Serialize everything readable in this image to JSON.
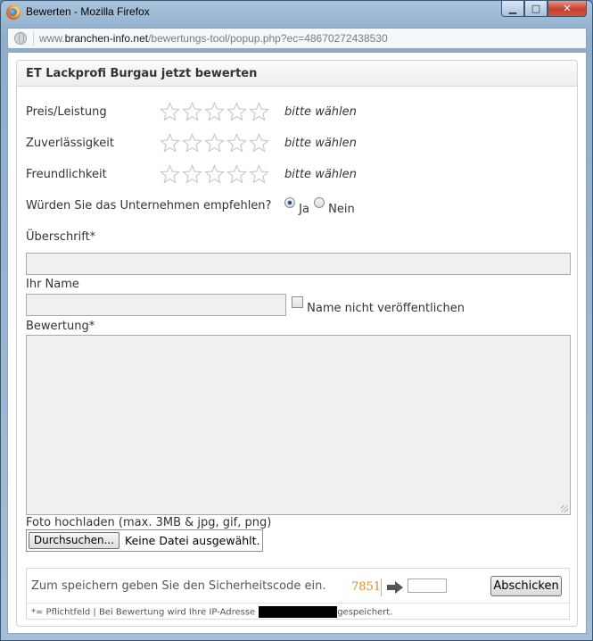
{
  "window": {
    "title": "Bewerten - Mozilla Firefox",
    "minimize_glyph": "▁",
    "maximize_glyph": "□",
    "close_glyph": "✕"
  },
  "urlbar": {
    "prefix": "www.",
    "domain": "branchen-info.net",
    "path": "/bewertungs-tool/popup.php?ec=48670272438530"
  },
  "form": {
    "heading": "ET Lackprofi Burgau jetzt bewerten",
    "ratings": [
      {
        "label": "Preis/Leistung",
        "hint": "bitte wählen",
        "stars_selected": 0,
        "stars_total": 5
      },
      {
        "label": "Zuverlässigkeit",
        "hint": "bitte wählen",
        "stars_selected": 0,
        "stars_total": 5
      },
      {
        "label": "Freundlichkeit",
        "hint": "bitte wählen",
        "stars_selected": 0,
        "stars_total": 5
      }
    ],
    "recommend": {
      "question": "Würden Sie das Unternehmen empfehlen?",
      "yes_label": "Ja",
      "no_label": "Nein",
      "selected": "Ja"
    },
    "headline_label": "Überschrift*",
    "headline_value": "",
    "name_label": "Ihr Name",
    "name_value": "",
    "hide_name_label": "Name nicht veröffentlichen",
    "hide_name_checked": false,
    "review_label": "Bewertung*",
    "review_value": "",
    "photo_label": "Foto hochladen (max. 3MB & jpg, gif, png)",
    "browse_label": "Durchsuchen...",
    "no_file_label": "Keine Datei ausgewählt.",
    "captcha_hint": "Zum speichern geben Sie den Sicherheitscode ein.",
    "captcha_code": "7851",
    "captcha_value": "",
    "submit_label": "Abschicken",
    "footer_note_before": "*= Pflichtfeld | Bei Bewertung wird Ihre IP-Adresse",
    "footer_note_after": "gespeichert."
  },
  "colors": {
    "captcha_code": "#e08a2a",
    "field_bg": "#f0f0f0",
    "star_outline": "#c8c8c8"
  }
}
